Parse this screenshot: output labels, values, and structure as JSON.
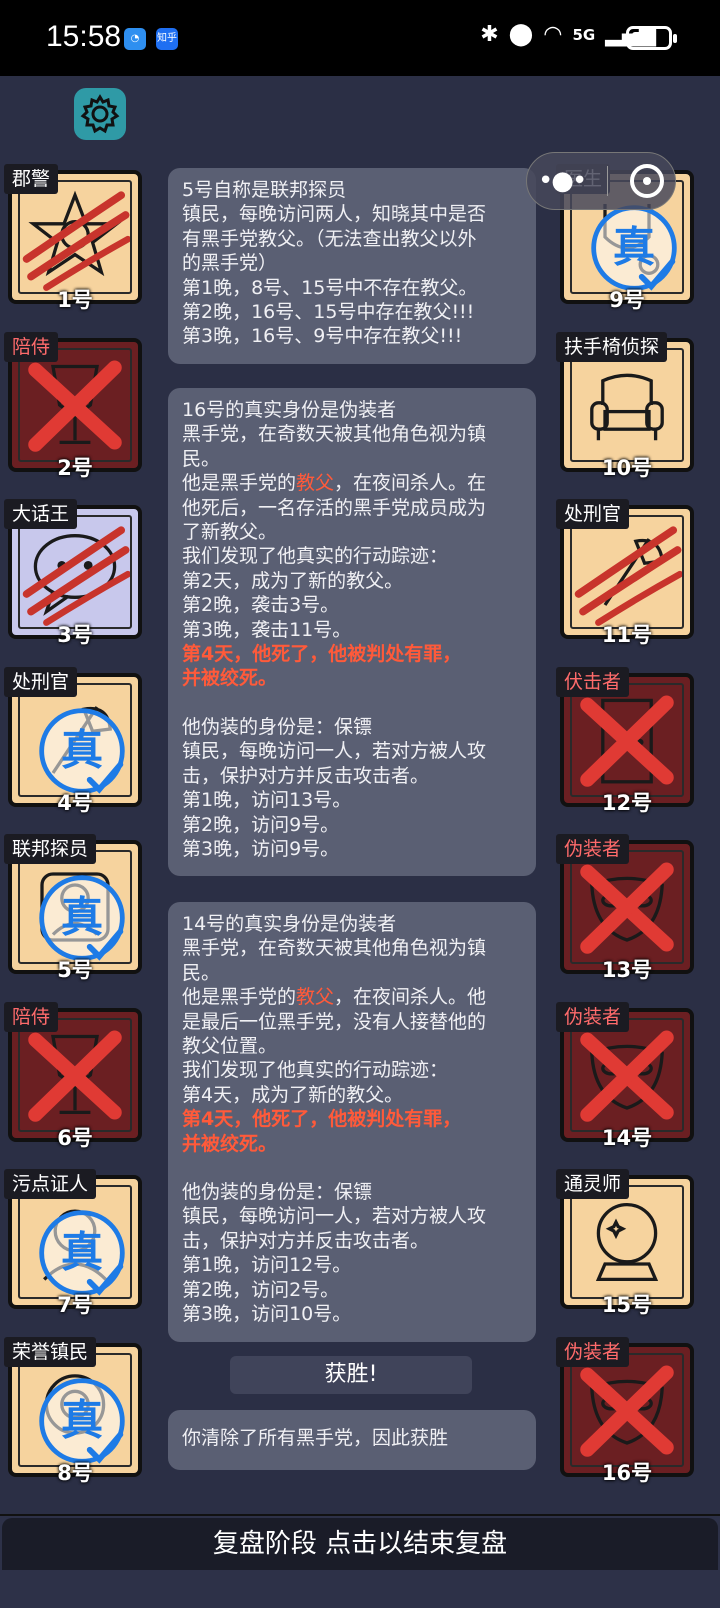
{
  "status_bar": {
    "time": "15:58",
    "app_icon_2": "知乎",
    "network": "5G"
  },
  "players_left": [
    {
      "num": "1号",
      "role": "郡警",
      "state": "clawed",
      "icon": "police-badge-icon",
      "role_color": "white"
    },
    {
      "num": "2号",
      "role": "陪侍",
      "state": "dead",
      "icon": "wine-glass-icon",
      "role_color": "red"
    },
    {
      "num": "3号",
      "role": "大话王",
      "state": "clawed",
      "icon": "speech-bubble-icon",
      "role_color": "white"
    },
    {
      "num": "4号",
      "role": "处刑官",
      "state": "true",
      "icon": "axe-icon",
      "role_color": "white"
    },
    {
      "num": "5号",
      "role": "联邦探员",
      "state": "true",
      "icon": "agent-icon",
      "role_color": "white"
    },
    {
      "num": "6号",
      "role": "陪侍",
      "state": "dead",
      "icon": "wine-glass-icon",
      "role_color": "red"
    },
    {
      "num": "7号",
      "role": "污点证人",
      "state": "true",
      "icon": "witness-icon",
      "role_color": "white"
    },
    {
      "num": "8号",
      "role": "荣誉镇民",
      "state": "true",
      "icon": "citizen-icon",
      "role_color": "white"
    }
  ],
  "players_right": [
    {
      "num": "9号",
      "role": "医生",
      "state": "true",
      "icon": "doctor-icon",
      "role_color": "white"
    },
    {
      "num": "10号",
      "role": "扶手椅侦探",
      "state": "alive",
      "icon": "armchair-icon",
      "role_color": "white"
    },
    {
      "num": "11号",
      "role": "处刑官",
      "state": "clawed",
      "icon": "axe-icon",
      "role_color": "white"
    },
    {
      "num": "12号",
      "role": "伏击者",
      "state": "dead",
      "icon": "door-icon",
      "role_color": "red"
    },
    {
      "num": "13号",
      "role": "伪装者",
      "state": "dead",
      "icon": "mask-icon",
      "role_color": "red"
    },
    {
      "num": "14号",
      "role": "伪装者",
      "state": "dead",
      "icon": "mask-icon",
      "role_color": "red"
    },
    {
      "num": "15号",
      "role": "通灵师",
      "state": "alive",
      "icon": "crystal-ball-icon",
      "role_color": "white"
    },
    {
      "num": "16号",
      "role": "伪装者",
      "state": "dead",
      "icon": "mask-icon",
      "role_color": "red"
    }
  ],
  "true_badge": "真",
  "messages": {
    "m1": {
      "l1": "5号自称是联邦探员",
      "l2": "镇民，每晚访问两人，知晓其中是否",
      "l3": "有黑手党教父。（无法查出教父以外",
      "l4": "的黑手党）",
      "l5": "第1晚，8号、15号中不存在教父。",
      "l6": "第2晚，16号、15号中存在教父!!!",
      "l7": "第3晚，16号、9号中存在教父!!!"
    },
    "m2": {
      "l1": "16号的真实身份是伪装者",
      "l2": "黑手党，在奇数天被其他角色视为镇",
      "l3": "民。",
      "l4a": "他是黑手党的",
      "l4b": "教父",
      "l4c": "，在夜间杀人。在",
      "l5": "他死后，一名存活的黑手党成员成为",
      "l6": "了新教父。",
      "l7": "我们发现了他真实的行动踪迹：",
      "l8": "第2天，成为了新的教父。",
      "l9": "第2晚，袭击3号。",
      "l10": "第3晚，袭击11号。",
      "l11": "第4天，他死了，他被判处有罪，",
      "l12": "并被绞死。",
      "l13": "他伪装的身份是：保镖",
      "l14": "镇民，每晚访问一人，若对方被人攻",
      "l15": "击，保护对方并反击攻击者。",
      "l16": "第1晚，访问13号。",
      "l17": "第2晚，访问9号。",
      "l18": "第3晚，访问9号。"
    },
    "m3": {
      "l1": "14号的真实身份是伪装者",
      "l2": "黑手党，在奇数天被其他角色视为镇",
      "l3": "民。",
      "l4a": "他是黑手党的",
      "l4b": "教父",
      "l4c": "，在夜间杀人。他",
      "l5": "是最后一位黑手党，没有人接替他的",
      "l6": "教父位置。",
      "l7": "我们发现了他真实的行动踪迹：",
      "l8": "第4天，成为了新的教父。",
      "l9": "第4天，他死了，他被判处有罪，",
      "l10": "并被绞死。",
      "l11": "他伪装的身份是：保镖",
      "l12": "镇民，每晚访问一人，若对方被人攻",
      "l13": "击，保护对方并反击攻击者。",
      "l14": "第1晚，访问12号。",
      "l15": "第2晚，访问2号。",
      "l16": "第3晚，访问10号。"
    },
    "win_title": "获胜!",
    "win_text": "你清除了所有黑手党，因此获胜"
  },
  "footer": {
    "label": "复盘阶段 点击以结束复盘"
  },
  "colors": {
    "background": "#2b2f45",
    "card_alive": "#f6d39e",
    "card_dead": "#6b1f22",
    "highlight": "#ff5a3a",
    "true_blue": "#1e7be6"
  }
}
